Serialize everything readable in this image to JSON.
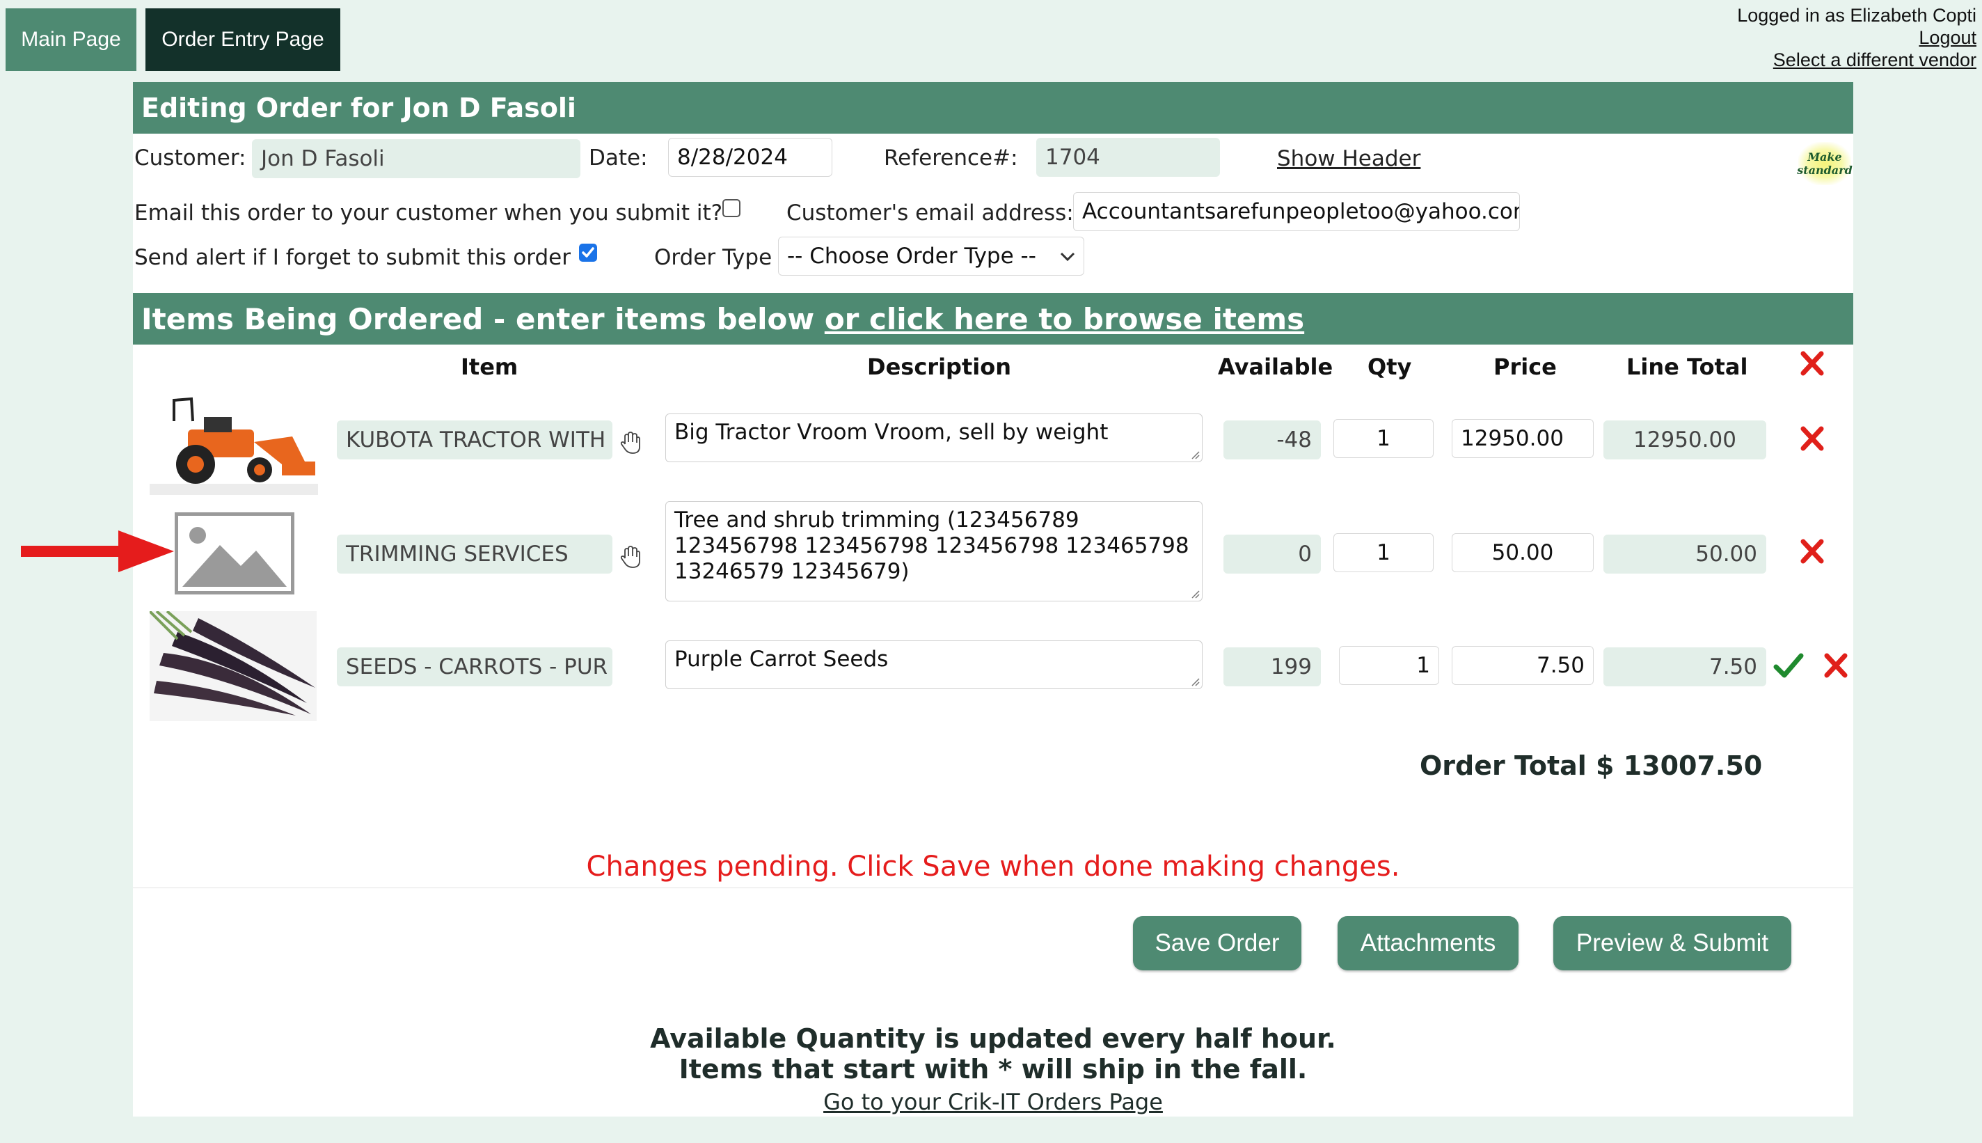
{
  "nav": {
    "main_page": "Main Page",
    "order_entry_page": "Order Entry Page"
  },
  "user": {
    "logged_in": "Logged in as Elizabeth Copti",
    "logout": "Logout",
    "select_vendor": "Select a different vendor"
  },
  "header": {
    "title": "Editing Order for Jon D Fasoli",
    "customer_label": "Customer:",
    "customer_value": "Jon D Fasoli",
    "date_label": "Date:",
    "date_value": "8/28/2024",
    "reference_label": "Reference#:",
    "reference_value": "1704",
    "show_header": "Show Header",
    "make_standard_line1": "Make",
    "make_standard_line2": "standard",
    "email_question": "Email this order to your customer when you submit it?",
    "email_checked": false,
    "customer_email_label": "Customer's email address:",
    "customer_email_value": "Accountantsarefunpeopletoo@yahoo.com",
    "alert_label": "Send alert if I forget to submit this order",
    "alert_checked": true,
    "order_type_label": "Order Type",
    "order_type_value": "-- Choose Order Type --"
  },
  "items_section": {
    "title": "Items Being Ordered - enter items below ",
    "browse_link": "or click here to browse items"
  },
  "columns": {
    "item": "Item",
    "description": "Description",
    "available": "Available",
    "qty": "Qty",
    "price": "Price",
    "line_total": "Line Total"
  },
  "rows": [
    {
      "item": "KUBOTA TRACTOR WITH",
      "description": "Big Tractor Vroom Vroom, sell by weight",
      "available": "-48",
      "qty": "1",
      "price": "12950.00",
      "line_total": "12950.00",
      "image": "tractor-image"
    },
    {
      "item": "TRIMMING SERVICES",
      "description": "Tree and shrub trimming (123456789 123456798  123456798 123456798 123465798 13246579 12345679)",
      "available": "0",
      "qty": "1",
      "price": "50.00",
      "line_total": "50.00",
      "image": "placeholder-image"
    },
    {
      "item": "SEEDS - CARROTS - PUR",
      "description": "Purple Carrot Seeds",
      "available": "199",
      "qty": "1",
      "price": "7.50",
      "line_total": "7.50",
      "image": "carrot-image"
    }
  ],
  "order_total": "Order Total $ 13007.50",
  "pending_message": "Changes pending. Click Save when done making changes.",
  "buttons": {
    "save": "Save Order",
    "attachments": "Attachments",
    "preview": "Preview & Submit"
  },
  "footer": {
    "line1": "Available Quantity is updated every half hour.",
    "line2": "Items that start with * will ship in the fall.",
    "orders_link": "Go to your Crik-IT Orders Page"
  },
  "colors": {
    "brand_green": "#4e8a72",
    "nav_active": "#13312a",
    "field_bg": "#e3efe9",
    "delete_red": "#e0201a",
    "pending_red": "#e51c1c",
    "confirm_green": "#1f8a2e"
  }
}
